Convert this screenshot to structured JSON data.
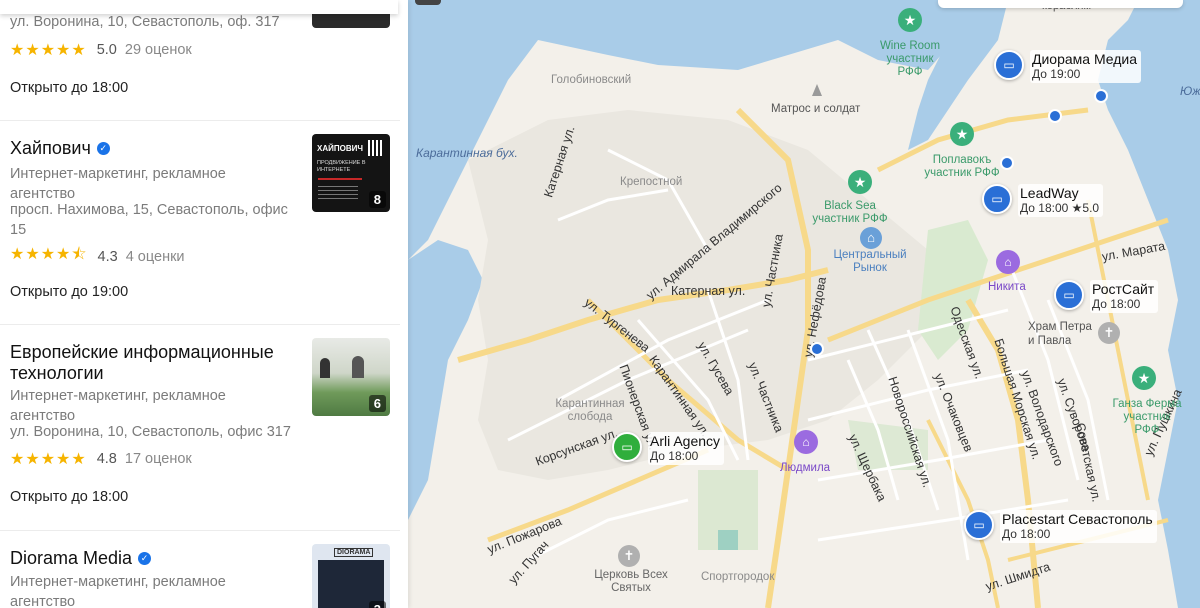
{
  "list": {
    "card0": {
      "address": "ул. Воронина, 10, Севастополь, оф. 317",
      "stars": "★★★★★",
      "rating": "5.0",
      "reviews": "29 оценок",
      "open": "Открыто до 18:00"
    },
    "card1": {
      "name": "Хайпович",
      "category": "Интернет-маркетинг, рекламное агентство",
      "address": "просп. Нахимова, 15, Севастополь, офис 15",
      "stars": "★★★★⯪",
      "rating": "4.3",
      "reviews": "4 оценки",
      "open": "Открыто до 19:00",
      "photo_count": "8",
      "thumb_brand": "ХАЙПОВИЧ",
      "thumb_caption": "ПРОДВИЖЕНИЕ В ИНТЕРНЕТЕ"
    },
    "card2": {
      "name": "Европейские информационные технологии",
      "category": "Интернет-маркетинг, рекламное агентство",
      "address": "ул. Воронина, 10, Севастополь, офис 317",
      "stars": "★★★★★",
      "rating": "4.8",
      "reviews": "17 оценок",
      "open": "Открыто до 18:00",
      "photo_count": "6"
    },
    "card3": {
      "name": "Diorama Media",
      "category": "Интернет-маркетинг, рекламное агентство",
      "photo_count": "3",
      "thumb_brand": "DIORAMA"
    }
  },
  "map": {
    "water_labels": [
      "Карантинная бух."
    ],
    "area_labels": [
      "Голобиновский",
      "Матрос и солдат",
      "Крепостной",
      "Карантинная слобода",
      "Спортгородок",
      "Церковь Всех Святых",
      "Храм Петра и Павла"
    ],
    "streets": [
      "Катерная ул.",
      "ул. Адмирала Владимирского",
      "Катерная ул.",
      "ул. Тургенева",
      "ул. Гусева",
      "Карантинная ул.",
      "Пионерская ул.",
      "Корсунская ул.",
      "ул. Пожарова",
      "ул. Частника",
      "ул. Нефёдова",
      "ул. Частника",
      "Новороссийская ул.",
      "ул. Щербака",
      "ул. Очаковцев",
      "Одесская ул.",
      "Большая Морская ул.",
      "ул. Володарского",
      "ул. Суворова",
      "Советская ул.",
      "ул. Пушкина",
      "ул. Марата",
      "ул. Шмидта",
      "ул. Пугач"
    ],
    "top_fragment": "кораблям",
    "right_fragment": "Юж",
    "poi_green": [
      "Wine Room участник РФФ",
      "Поплавокъ участник РФФ",
      "Black Sea участник РФФ",
      "Ганза Ферма участник РФФ"
    ],
    "poi_market": "Центральный Рынок",
    "poi_hotels": [
      "Никита",
      "Людмила"
    ],
    "pins": [
      {
        "name": "Диорама Медиа",
        "hours": "До 19:00"
      },
      {
        "name": "LeadWay",
        "hours": "До 18:00 ★5.0"
      },
      {
        "name": "РостСайт",
        "hours": "До 18:00"
      },
      {
        "name": "Arli Agency",
        "hours": "До 18:00"
      },
      {
        "name": "Placestart Севастополь",
        "hours": "До 18:00"
      }
    ]
  },
  "colors": {
    "star": "#f6b400",
    "pin_blue": "#2a6fd6",
    "pin_green": "#2fae3c",
    "water": "#a9cce8",
    "poi_green": "#3aaf7b",
    "poi_purple": "#9b6be0"
  },
  "icons": [
    "verified-icon",
    "laptop-icon",
    "star-icon",
    "hotel-icon",
    "church-icon",
    "market-icon",
    "monument-icon"
  ]
}
